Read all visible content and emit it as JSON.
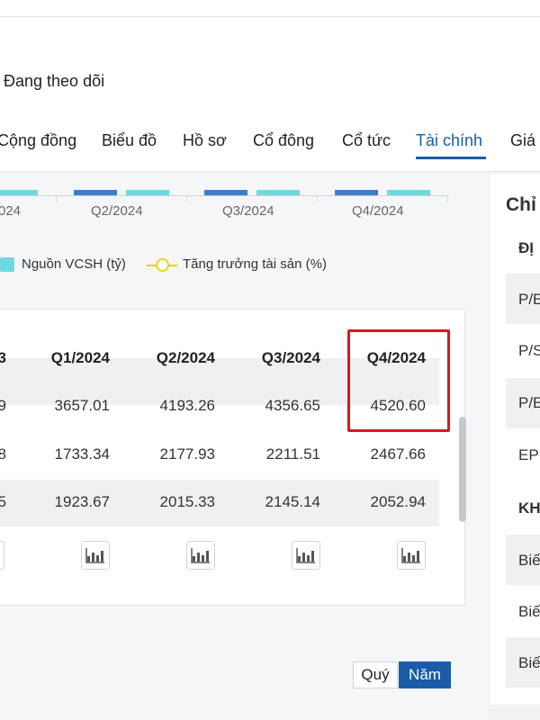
{
  "header": {
    "follow_label": "Đang theo dõi"
  },
  "tabs": [
    {
      "label": "Cộng đồng"
    },
    {
      "label": "Biểu đồ"
    },
    {
      "label": "Hồ sơ"
    },
    {
      "label": "Cổ đông"
    },
    {
      "label": "Cổ tức"
    },
    {
      "label": "Tài chính",
      "active": true
    },
    {
      "label": "Giá"
    }
  ],
  "chart_data": {
    "type": "bar",
    "categories": [
      "024",
      "Q2/2024",
      "Q3/2024",
      "Q4/2024"
    ],
    "legend": [
      "Nguồn VCSH (tỷ)",
      "Tăng trưởng tài sản (%)"
    ],
    "colors": {
      "bar_dark": "#3d7ec9",
      "bar_light": "#6fd9e0",
      "line": "#e8d31f"
    }
  },
  "table": {
    "headers": [
      "3",
      "Q1/2024",
      "Q2/2024",
      "Q3/2024",
      "Q4/2024"
    ],
    "rows": [
      [
        "9",
        "3657.01",
        "4193.26",
        "4356.65",
        "4520.60"
      ],
      [
        "8",
        "1733.34",
        "2177.93",
        "2211.51",
        "2467.66"
      ],
      [
        "5",
        "1923.67",
        "2015.33",
        "2145.14",
        "2052.94"
      ]
    ]
  },
  "period_toggle": {
    "quarter_label": "Quý",
    "year_label": "Năm",
    "selected": "Năm"
  },
  "right_panel": {
    "title": "Chỉ",
    "section1": "ĐỊ",
    "items1": [
      "P/E",
      "P/S",
      "P/E",
      "EP"
    ],
    "section2": "KH",
    "items2": [
      "Biế",
      "Biế",
      "Biế"
    ]
  },
  "colors": {
    "accent": "#1a5ca8",
    "highlight": "#e0141e"
  }
}
